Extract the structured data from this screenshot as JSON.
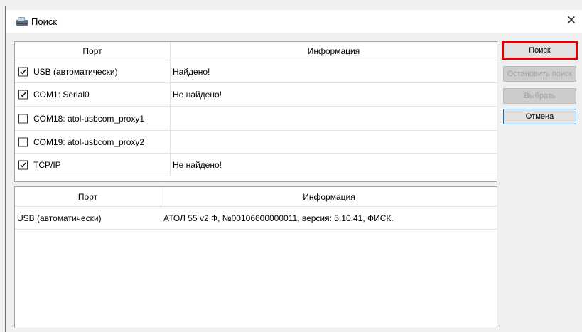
{
  "window": {
    "title": "Поиск",
    "close_glyph": "✕"
  },
  "top_table": {
    "headers": {
      "port": "Порт",
      "info": "Информация"
    },
    "rows": [
      {
        "port": "USB (автоматически)",
        "checked": true,
        "info": "Найдено!"
      },
      {
        "port": "COM1: Serial0",
        "checked": true,
        "info": "Не найдено!"
      },
      {
        "port": "COM18: atol-usbcom_proxy1",
        "checked": false,
        "info": ""
      },
      {
        "port": "COM19: atol-usbcom_proxy2",
        "checked": false,
        "info": ""
      },
      {
        "port": "TCP/IP",
        "checked": true,
        "info": "Не найдено!"
      }
    ]
  },
  "bottom_table": {
    "headers": {
      "port": "Порт",
      "info": "Информация"
    },
    "rows": [
      {
        "port": "USB (автоматически)",
        "info": "АТОЛ 55 v2 Ф, №00106600000011, версия: 5.10.41, ФИСК."
      }
    ]
  },
  "buttons": {
    "search": "Поиск",
    "stop_search": "Остановить поиск",
    "select": "Выбрать",
    "cancel": "Отмена"
  },
  "colors": {
    "highlight": "#e00000",
    "focus_border": "#0078d7"
  }
}
